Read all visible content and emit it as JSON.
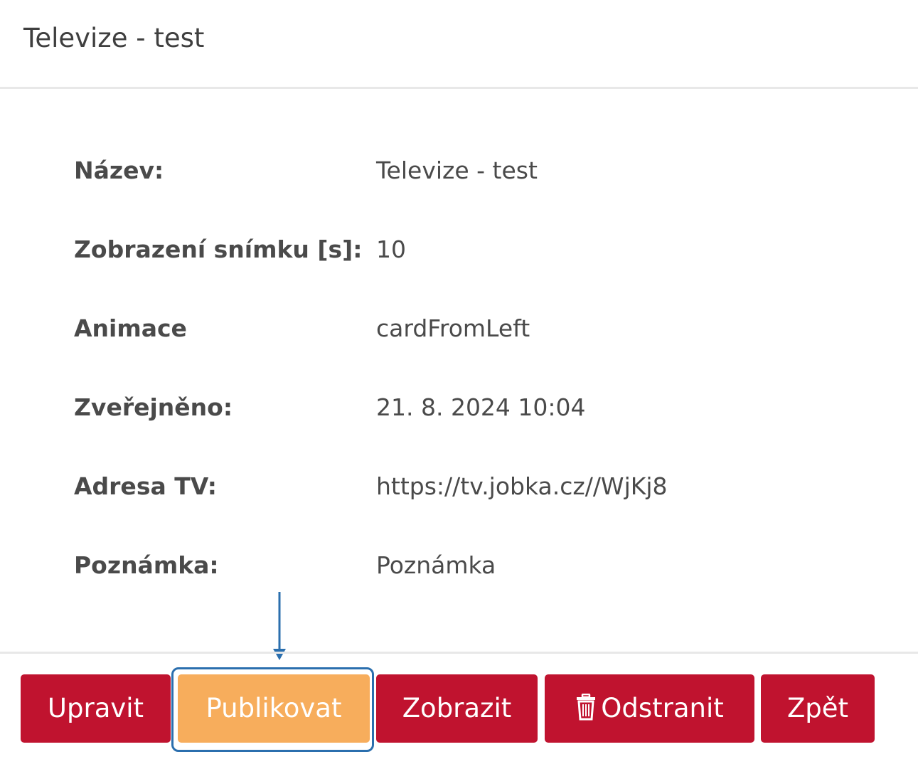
{
  "header": {
    "title": "Televize - test"
  },
  "details": [
    {
      "label": "Název:",
      "value": "Televize - test"
    },
    {
      "label": "Zobrazení snímku [s]:",
      "value": "10"
    },
    {
      "label": "Animace",
      "value": "cardFromLeft"
    },
    {
      "label": "Zveřejněno:",
      "value": "21. 8. 2024 10:04"
    },
    {
      "label": "Adresa TV:",
      "value": "https://tv.jobka.cz//WjKj8"
    },
    {
      "label": "Poznámka:",
      "value": "Poznámka"
    }
  ],
  "actions": {
    "edit_label": "Upravit",
    "publish_label": "Publikovat",
    "view_label": "Zobrazit",
    "delete_label": "Odstranit",
    "delete_icon": "trash-icon",
    "back_label": "Zpět"
  },
  "colors": {
    "primary_button": "#c0132f",
    "publish_button": "#f7ad5c",
    "highlight": "#2b6fae",
    "text": "#4a4a4a"
  }
}
